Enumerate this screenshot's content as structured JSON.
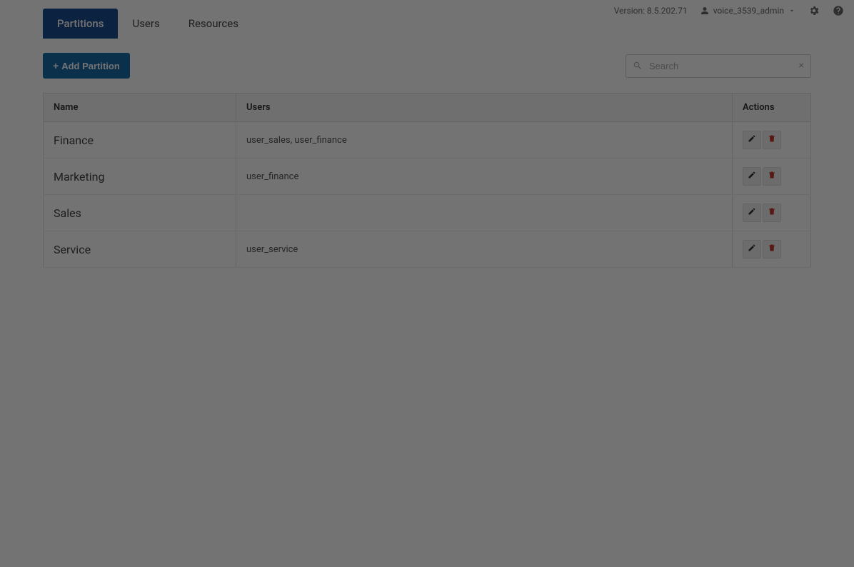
{
  "header": {
    "version": "Version: 8.5.202.71",
    "username": "voice_3539_admin"
  },
  "tabs": {
    "partitions": "Partitions",
    "users": "Users",
    "resources": "Resources"
  },
  "toolbar": {
    "add_label": "Add Partition",
    "search_placeholder": "Search"
  },
  "table": {
    "headers": {
      "name": "Name",
      "users": "Users",
      "actions": "Actions"
    },
    "rows": [
      {
        "name": "Finance",
        "users": "user_sales, user_finance"
      },
      {
        "name": "Marketing",
        "users": "user_finance"
      },
      {
        "name": "Sales",
        "users": ""
      },
      {
        "name": "Service",
        "users": "user_service"
      }
    ]
  }
}
